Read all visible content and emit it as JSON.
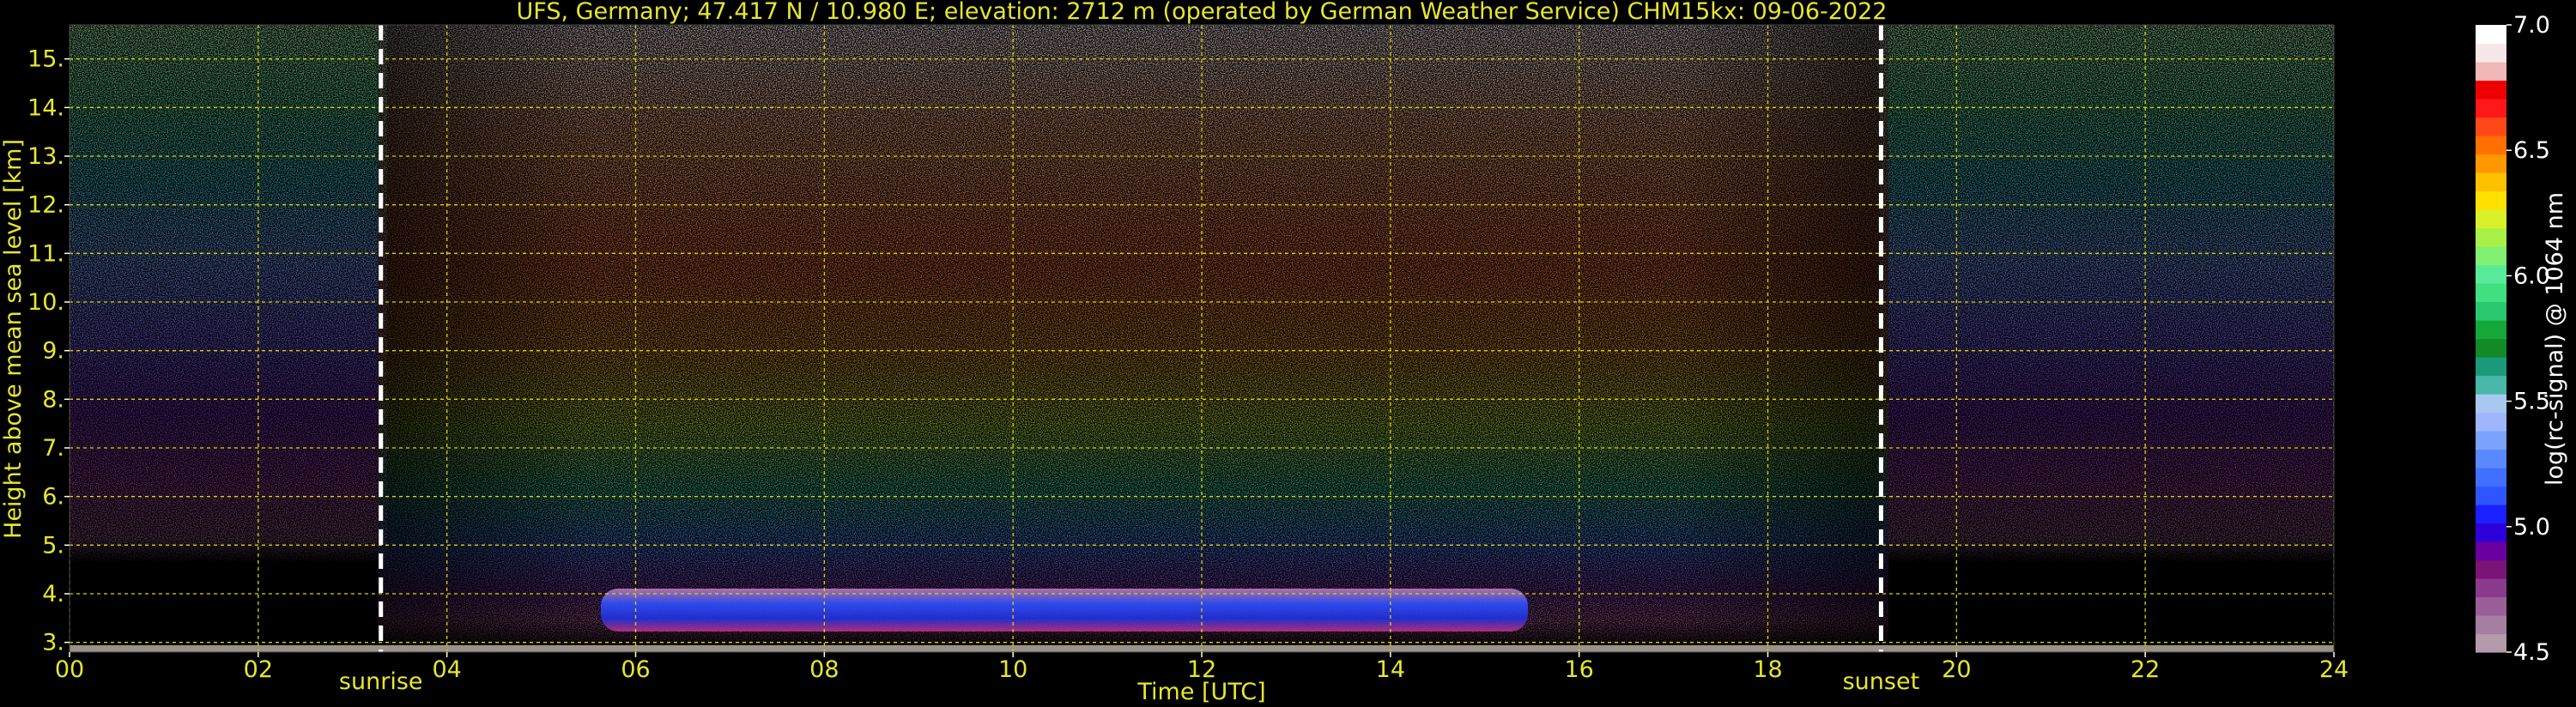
{
  "title": "UFS, Germany; 47.417 N / 10.980 E; elevation: 2712 m  (operated by German Weather Service)    CHM15kx: 09-06-2022",
  "colors": {
    "axis_text": "#e6e62e",
    "grid": "#d8d800",
    "background": "#000000",
    "marker_lines": "#ffffff"
  },
  "chart_data": {
    "type": "heatmap",
    "title": "UFS, Germany; 47.417 N / 10.980 E; elevation: 2712 m  (operated by German Weather Service)    CHM15kx: 09-06-2022",
    "xlabel": "Time [UTC]",
    "ylabel": "Height above mean sea level [km]",
    "xlim": [
      0,
      24
    ],
    "ylim": [
      2.8,
      15.7
    ],
    "x_ticks": [
      0,
      2,
      4,
      6,
      8,
      10,
      12,
      14,
      16,
      18,
      20,
      22,
      24
    ],
    "x_tick_labels": [
      "00",
      "02",
      "04",
      "06",
      "08",
      "10",
      "12",
      "14",
      "16",
      "18",
      "20",
      "22",
      "24"
    ],
    "y_ticks": [
      3,
      4,
      5,
      6,
      7,
      8,
      9,
      10,
      11,
      12,
      13,
      14,
      15
    ],
    "y_tick_labels": [
      "3.",
      "4.",
      "5.",
      "6.",
      "7.",
      "8.",
      "9.",
      "10.",
      "11.",
      "12.",
      "13.",
      "14.",
      "15."
    ],
    "grid": true,
    "annotations": [
      {
        "name": "sunrise",
        "x": 3.3,
        "label": "sunrise"
      },
      {
        "name": "sunset",
        "x": 19.2,
        "label": "sunset"
      }
    ],
    "colorbar": {
      "label": "log(rc-signal) @ 1064 nm",
      "range": [
        4.5,
        7.0
      ],
      "ticks": [
        4.5,
        5.0,
        5.5,
        6.0,
        6.5,
        7.0
      ],
      "tick_labels": [
        "4.5",
        "5.0",
        "5.5",
        "6.0",
        "6.5",
        "7.0"
      ],
      "colors": [
        "#b49aaa",
        "#a57ea2",
        "#9a5f98",
        "#8a3a8c",
        "#7a1477",
        "#6a00a0",
        "#2d00d8",
        "#1a20ff",
        "#2f55ff",
        "#4070ff",
        "#5a88ff",
        "#7aa2ff",
        "#9fb6ff",
        "#a8c8f0",
        "#48b8a8",
        "#1a9a7a",
        "#128a28",
        "#15a838",
        "#2ac870",
        "#40e080",
        "#58ea98",
        "#80f070",
        "#a8f048",
        "#d8f028",
        "#ffe000",
        "#ffc000",
        "#ff9800",
        "#ff7000",
        "#ff4818",
        "#ff1818",
        "#ee0000",
        "#f0b8b8",
        "#f6e8e8",
        "#ffffff"
      ]
    }
  }
}
